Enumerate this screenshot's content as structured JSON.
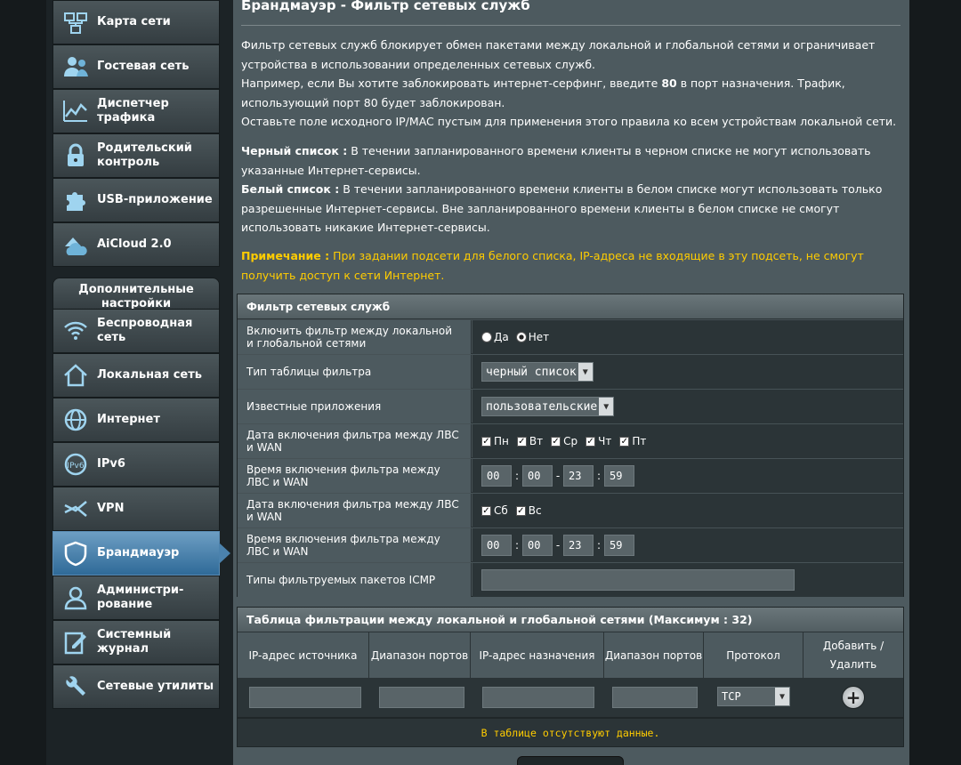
{
  "sidebar": {
    "items": [
      {
        "label": "Карта сети",
        "icon": "network-map-icon"
      },
      {
        "label": "Гостевая сеть",
        "icon": "guest-network-icon"
      },
      {
        "label": "Диспетчер\nтрафика",
        "icon": "traffic-manager-icon"
      },
      {
        "label": "Родительский\nконтроль",
        "icon": "parental-control-icon"
      },
      {
        "label": "USB-приложение",
        "icon": "usb-app-icon"
      },
      {
        "label": "AiCloud 2.0",
        "icon": "aicloud-icon"
      }
    ],
    "advanced_header": "Дополнительные\nнастройки",
    "advanced_items": [
      {
        "label": "Беспроводная\nсеть",
        "icon": "wireless-icon"
      },
      {
        "label": "Локальная сеть",
        "icon": "lan-icon"
      },
      {
        "label": "Интернет",
        "icon": "internet-icon"
      },
      {
        "label": "IPv6",
        "icon": "ipv6-icon"
      },
      {
        "label": "VPN",
        "icon": "vpn-icon"
      },
      {
        "label": "Брандмауэр",
        "icon": "firewall-icon",
        "active": true
      },
      {
        "label": "Администри-\nрование",
        "icon": "administration-icon"
      },
      {
        "label": "Системный\nжурнал",
        "icon": "system-log-icon"
      },
      {
        "label": "Сетевые утилиты",
        "icon": "network-tools-icon"
      }
    ]
  },
  "page": {
    "title": "Брандмауэр - Фильтр сетевых служб",
    "desc1": "Фильтр сетевых служб блокирует обмен пакетами между локальной и глобальной сетями и ограничивает устройства в использовании определенных сетевых служб.",
    "desc2_a": "Например, если Вы хотите заблокировать интернет-серфинг, введите ",
    "desc2_b": "80",
    "desc2_c": " в порт назначения. Трафик, использующий порт 80 будет заблокирован.",
    "desc3": "Оставьте поле исходного IP/MAC пустым для применения этого правила ко всем устройствам локальной сети.",
    "black_label": "Черный список :",
    "black_text": " В течении запланированного времени клиенты в черном списке не могут использовать указанные Интернет-сервисы.",
    "white_label": "Белый список :",
    "white_text": " В течении запланированного времени клиенты в белом списке могут использовать только разрешенные Интернет-сервисы. Вне запланированного времени клиенты в белом списке не смогут использовать никакие Интернет-сервисы.",
    "note_label": "Примечание :",
    "note_text": " При задании подсети для белого списка, IP-адреса не входящие в эту подсеть, не смогут получить доступ к сети Интернет."
  },
  "filter": {
    "header": "Фильтр сетевых служб",
    "enable_label": "Включить фильтр между локальной и глобальной сетями",
    "yes": "Да",
    "no": "Нет",
    "table_type_label": "Тип таблицы фильтра",
    "table_type_value": "черный список",
    "known_apps_label": "Известные приложения",
    "known_apps_value": "пользовательские",
    "date1_label": "Дата включения фильтра между ЛВС и WAN",
    "weekdays": [
      "Пн",
      "Вт",
      "Ср",
      "Чт",
      "Пт"
    ],
    "time1_label": "Время включения фильтра между ЛВС и WAN",
    "time1": {
      "h1": "00",
      "m1": "00",
      "h2": "23",
      "m2": "59"
    },
    "date2_label": "Дата включения фильтра между ЛВС и WAN",
    "weekend": [
      "Сб",
      "Вс"
    ],
    "time2_label": "Время включения фильтра между ЛВС и WAN",
    "time2": {
      "h1": "00",
      "m1": "00",
      "h2": "23",
      "m2": "59"
    },
    "icmp_label": "Типы фильтруемых пакетов ICMP",
    "dash": "-",
    "colon": ":"
  },
  "rules": {
    "header": "Таблица фильтрации между локальной и глобальной сетями (Максимум : 32)",
    "columns": [
      "IP-адрес источника",
      "Диапазон портов",
      "IP-адрес назначения",
      "Диапазон портов",
      "Протокол",
      "Добавить / Удалить"
    ],
    "protocol_value": "TCP",
    "empty_message": "В таблице отсутствуют данные."
  }
}
